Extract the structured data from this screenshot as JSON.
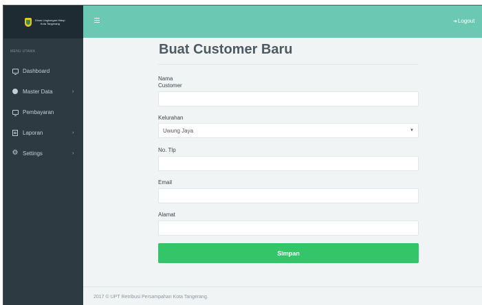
{
  "brand": {
    "line1": "Dinas Lingkungan Hidup",
    "line2": "Kota Tangerang"
  },
  "topbar": {
    "menu_icon": "hamburger-icon",
    "logout_icon": "sign-out-icon",
    "logout_label": "Logout"
  },
  "sidebar": {
    "header": "MENU UTAMA",
    "items": [
      {
        "label": "Dashboard",
        "icon": "monitor-icon",
        "has_submenu": false
      },
      {
        "label": "Master Data",
        "icon": "database-icon",
        "has_submenu": true
      },
      {
        "label": "Pembayaran",
        "icon": "monitor-icon",
        "has_submenu": false
      },
      {
        "label": "Laporan",
        "icon": "report-icon",
        "has_submenu": true
      },
      {
        "label": "Settings",
        "icon": "gear-icon",
        "has_submenu": true
      }
    ],
    "arrow_glyph": "›"
  },
  "form": {
    "title": "Buat Customer Baru",
    "nama_label_line1": "Nama",
    "nama_label_line2": "Customer",
    "nama_value": "",
    "kelurahan_label": "Kelurahan",
    "kelurahan_selected": "Uwung Jaya",
    "telp_label": "No. Tlp",
    "telp_value": "",
    "email_label": "Email",
    "email_value": "",
    "alamat_label": "Alamat",
    "alamat_value": "",
    "submit_label": "Simpan"
  },
  "footer": {
    "text": "2017 © UPT Retribusi Persampahan Kota Tangerang."
  },
  "colors": {
    "topbar": "#6bc8b2",
    "sidebar": "#2e3a42",
    "brand_bg": "#1f2b33",
    "button": "#35c569",
    "content_bg": "#f1f4f5"
  }
}
